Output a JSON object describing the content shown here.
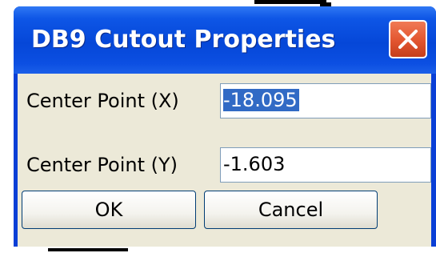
{
  "window": {
    "title": "DB9 Cutout Properties"
  },
  "fields": {
    "center_x_label": "Center Point (X)",
    "center_x_value": "-18.095",
    "center_y_label": "Center Point (Y)",
    "center_y_value": "-1.603"
  },
  "buttons": {
    "ok_label": "OK",
    "cancel_label": "Cancel"
  },
  "icons": {
    "close": "close-icon"
  },
  "colors": {
    "titlebar": "#0547d8",
    "close_button": "#e2552f",
    "dialog_face": "#ece9d8",
    "selection": "#316ac5"
  }
}
